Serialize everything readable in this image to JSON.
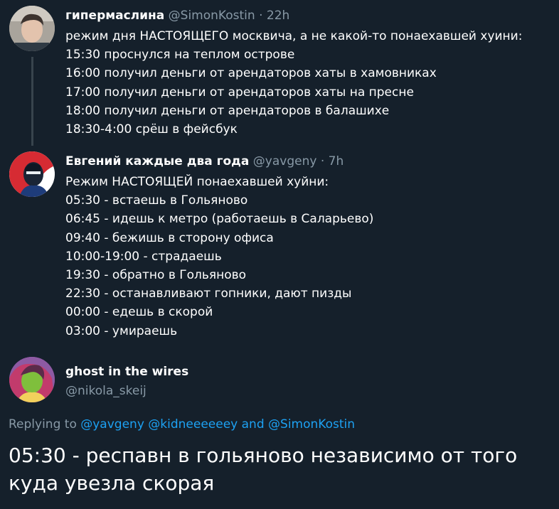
{
  "tweets": [
    {
      "name": "гипермаслина",
      "handle": "@SimonKostin",
      "separator": "·",
      "time": "22h",
      "lines": [
        "режим дня НАСТОЯЩЕГО москвича, а не какой-то понаехавшей хуини:",
        "15:30 проснулся на теплом острове",
        "16:00 получил деньги от арендаторов хаты в хамовниках",
        "17:00 получил деньги от арендаторов хаты на пресне",
        "18:00 получил деньги от арендаторов в балашихе",
        "18:30-4:00 срёш в фейсбук"
      ]
    },
    {
      "name": "Евгений каждые два года",
      "handle": "@yavgeny",
      "separator": "·",
      "time": "7h",
      "lines": [
        "Режим НАСТОЯЩЕЙ понаехавшей хуйни:",
        "05:30 - встаешь в Гольяново",
        "06:45 - идешь к метро (работаешь в Саларьево)",
        "09:40 - бежишь в сторону офиса",
        "10:00-19:00 - страдаешь",
        "19:30 - обратно в Гольяново",
        "22:30 - останавливают гопники, дают пизды",
        "00:00 - едешь в скорой",
        "03:00 - умираешь"
      ]
    }
  ],
  "main_tweet": {
    "name": "ghost in the wires",
    "handle": "@nikola_skeij",
    "replying_label": "Replying to",
    "mentions": [
      "@yavgeny",
      "@kidneeeeeey"
    ],
    "and_label": "and",
    "last_mention": "@SimonKostin",
    "text": "05:30 - респавн в гольяново независимо от того куда увезла скорая"
  },
  "colors": {
    "background": "#15202b",
    "secondary_text": "#8899a6",
    "link": "#1da1f2",
    "thread_line": "#38444d"
  }
}
